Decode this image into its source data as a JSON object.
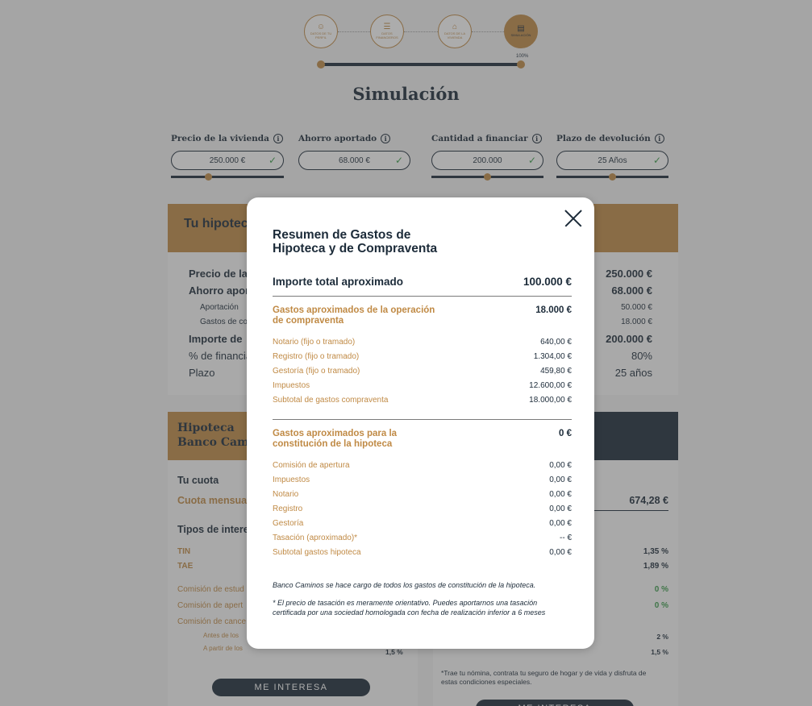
{
  "steps": [
    {
      "label": "DATOS DE TU PERFIL",
      "icon": "user-icon"
    },
    {
      "label": "DATOS FINANCIEROS",
      "icon": "sliders-icon"
    },
    {
      "label": "DATOS DE LA VIVIENDA",
      "icon": "house-icon"
    },
    {
      "label": "SIMULACIÓN",
      "icon": "document-icon"
    }
  ],
  "progress_label": "100%",
  "progress": 1.0,
  "page_title": "Simulación",
  "fields": [
    {
      "label": "Precio de la vivienda",
      "value": "250.000 €",
      "level": 0.33
    },
    {
      "label": "Ahorro aportado",
      "value": "68.000 €",
      "level": 0.5
    },
    {
      "label": "Cantidad a financiar",
      "value": "200.000",
      "level": 0.5
    },
    {
      "label": "Plazo de devolución",
      "value": "25 Años",
      "level": 0.5
    }
  ],
  "card1": {
    "heading": "Tu hipoteca",
    "rows": [
      {
        "label": "Precio de la",
        "value": "250.000 €"
      },
      {
        "label": "Ahorro apor",
        "value": "68.000 €"
      },
      {
        "label": "Aportación",
        "value": "50.000 €"
      },
      {
        "label": "Gastos de co",
        "value": "18.000 €"
      },
      {
        "label": "Importe de",
        "value": "200.000 €"
      },
      {
        "label": "% de financia",
        "value": "80%"
      },
      {
        "label": "Plazo",
        "value": "25 años"
      }
    ]
  },
  "card2": {
    "heading_line1": "Hipoteca",
    "heading_line2": "Banco Camin",
    "cuota_title": "Tu cuota",
    "cuota_label": "Cuota mensua",
    "tipos_title": "Tipos de intere",
    "tin": "TIN",
    "tae": "TAE",
    "comision_estudio": "Comisión de estud",
    "comision_apertura": "Comisión de apert",
    "comision_cancel": "Comisión de cance",
    "antes": "Antes de los",
    "a_partir": "A partir de los",
    "a_partir_value": "1,5 %",
    "button": "ME INTERESA"
  },
  "card3": {
    "cuota_value": "674,28 €",
    "tin_value": "1,35 %",
    "tae_value": "1,89 %",
    "estudio_value": "0 %",
    "apertura_value": "0 %",
    "antes_value": "2 %",
    "a_partir_value": "1,5 %",
    "note": "*Trae tu nómina, contrata tu seguro de hogar y de vida y disfruta de estas condiciones especiales.",
    "button": "ME INTERESA"
  },
  "modal": {
    "title": "Resumen de Gastos de Hipoteca y de Compraventa",
    "total_label": "Importe total aproximado",
    "total_value": "100.000 €",
    "section1": {
      "title": "Gastos aproximados de la operación de compraventa",
      "value": "18.000 €",
      "items": [
        {
          "label": "Notario (fijo o tramado)",
          "value": "640,00 €"
        },
        {
          "label": "Registro (fijo o tramado)",
          "value": "1.304,00 €"
        },
        {
          "label": "Gestoría (fijo o tramado)",
          "value": "459,80 €"
        },
        {
          "label": "Impuestos",
          "value": "12.600,00 €"
        },
        {
          "label": "Subtotal de gastos compraventa",
          "value": "18.000,00 €"
        }
      ]
    },
    "section2": {
      "title": "Gastos aproximados para la constitución de la hipoteca",
      "value": "0 €",
      "items": [
        {
          "label": "Comisión de apertura",
          "value": "0,00 €"
        },
        {
          "label": "Impuestos",
          "value": "0,00 €"
        },
        {
          "label": "Notario",
          "value": "0,00 €"
        },
        {
          "label": "Registro",
          "value": "0,00 €"
        },
        {
          "label": "Gestoría",
          "value": "0,00 €"
        },
        {
          "label": "Tasación (aproximado)*",
          "value": "-- €"
        },
        {
          "label": "Subtotal gastos hipoteca",
          "value": "0,00 €"
        }
      ]
    },
    "note1": "Banco Caminos se hace cargo de todos los gastos de constitución de la hipoteca.",
    "note2": "* El precio de tasación es meramente orientativo. Puedes aportarnos una tasación certificada por una sociedad homologada con fecha de realización inferior a 6 meses"
  },
  "colors": {
    "accent": "#c08a45",
    "navy": "#1c2b39",
    "success": "#3a9c4a"
  }
}
